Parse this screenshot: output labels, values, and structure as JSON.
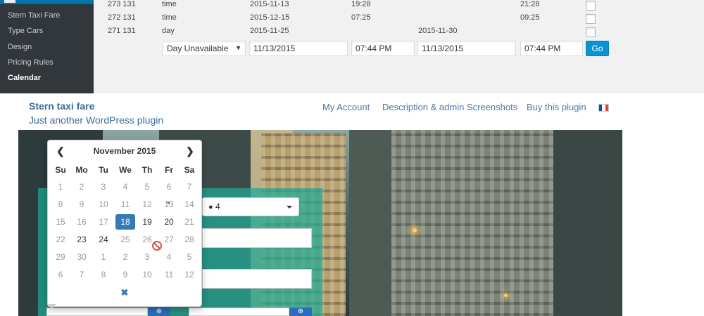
{
  "admin": {
    "sidebar": {
      "items": [
        {
          "label": "Stern Taxi Fare"
        },
        {
          "label": "Type Cars"
        },
        {
          "label": "Design"
        },
        {
          "label": "Pricing Rules"
        },
        {
          "label": "Calendar"
        }
      ],
      "current": "Calendar"
    },
    "rows": [
      {
        "ids": "273 131",
        "type": "time",
        "date_from": "2015-11-13",
        "time_from": "19:28",
        "date_to": "",
        "time_to": "21:28"
      },
      {
        "ids": "272 131",
        "type": "time",
        "date_from": "2015-12-15",
        "time_from": "07:25",
        "date_to": "",
        "time_to": "09:25"
      },
      {
        "ids": "271 131",
        "type": "day",
        "date_from": "2015-11-25",
        "time_from": "",
        "date_to": "2015-11-30",
        "time_to": ""
      }
    ],
    "new_rule": {
      "type_value": "Day Unavailable",
      "date_from": "11/13/2015",
      "time_from": "07:44 PM",
      "date_to": "11/13/2015",
      "time_to": "07:44 PM",
      "go_label": "Go"
    }
  },
  "site": {
    "title": "Stern taxi fare",
    "tagline": "Just another WordPress plugin",
    "nav": [
      {
        "label": "My Account"
      },
      {
        "label": "Description & admin Screenshots"
      },
      {
        "label": "Buy this plugin"
      }
    ],
    "flag_colors": [
      "#0055a4",
      "#ffffff",
      "#ef4135"
    ]
  },
  "booking": {
    "passengers_value": "4",
    "passengers_icon": "user-icon"
  },
  "datepicker": {
    "month_label": "November 2015",
    "prev_icon": "chevron-left-icon",
    "next_icon": "chevron-right-icon",
    "clear_icon": "close-icon",
    "weekdays": [
      "Su",
      "Mo",
      "Tu",
      "We",
      "Th",
      "Fr",
      "Sa"
    ],
    "weeks": [
      [
        {
          "d": "1"
        },
        {
          "d": "2"
        },
        {
          "d": "3"
        },
        {
          "d": "4"
        },
        {
          "d": "5"
        },
        {
          "d": "6"
        },
        {
          "d": "7"
        }
      ],
      [
        {
          "d": "8"
        },
        {
          "d": "9"
        },
        {
          "d": "10"
        },
        {
          "d": "11"
        },
        {
          "d": "12"
        },
        {
          "d": "13"
        },
        {
          "d": "14"
        }
      ],
      [
        {
          "d": "15"
        },
        {
          "d": "16"
        },
        {
          "d": "17"
        },
        {
          "d": "18",
          "active": true
        },
        {
          "d": "19",
          "avail": true
        },
        {
          "d": "20",
          "avail": true
        },
        {
          "d": "21"
        }
      ],
      [
        {
          "d": "22"
        },
        {
          "d": "23",
          "avail": true
        },
        {
          "d": "24",
          "avail": true
        },
        {
          "d": "25"
        },
        {
          "d": "26"
        },
        {
          "d": "27"
        },
        {
          "d": "28"
        }
      ],
      [
        {
          "d": "29"
        },
        {
          "d": "30"
        },
        {
          "d": "1"
        },
        {
          "d": "2"
        },
        {
          "d": "3"
        },
        {
          "d": "4"
        },
        {
          "d": "5"
        }
      ],
      [
        {
          "d": "6"
        },
        {
          "d": "7"
        },
        {
          "d": "8"
        },
        {
          "d": "9"
        },
        {
          "d": "10"
        },
        {
          "d": "11"
        },
        {
          "d": "12"
        }
      ]
    ],
    "selected": "18"
  }
}
